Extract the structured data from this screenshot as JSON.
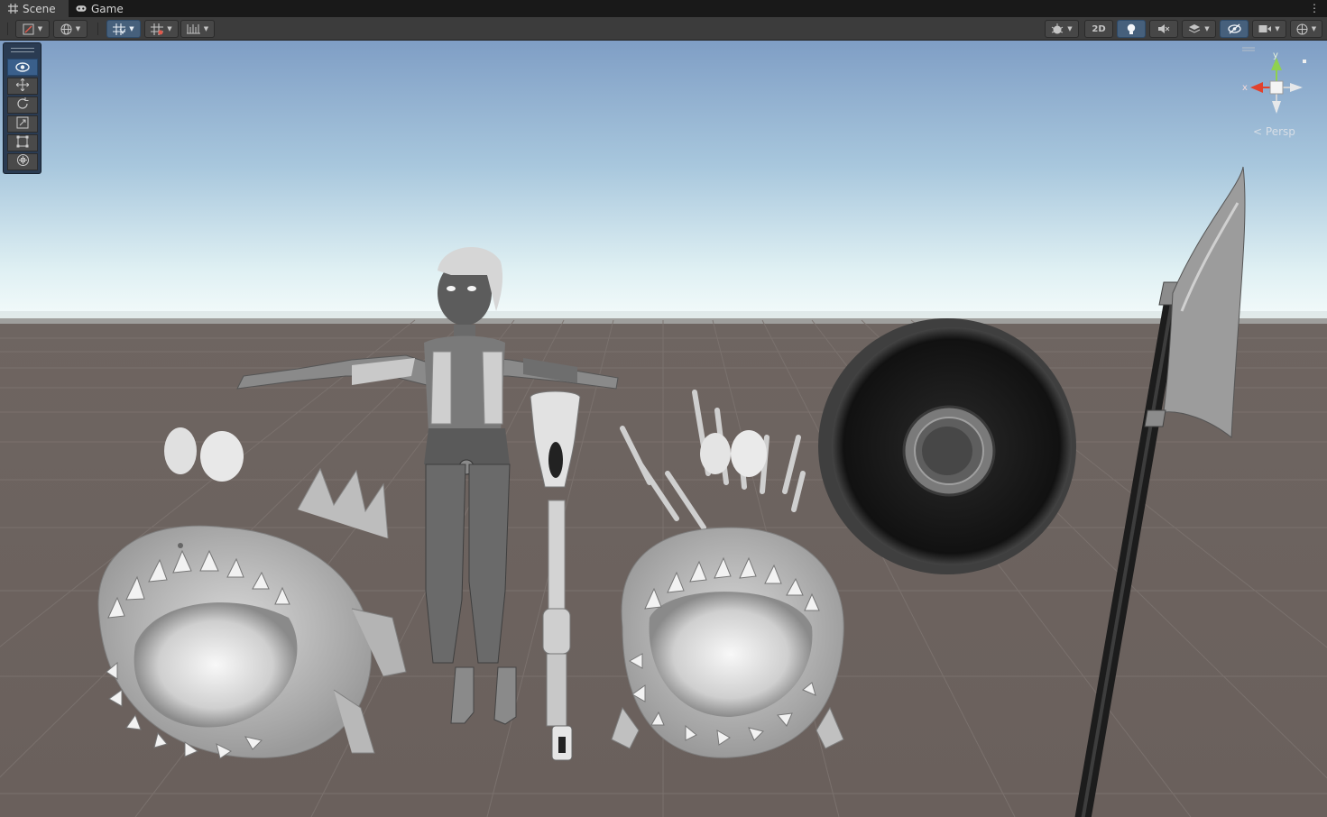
{
  "tabs": [
    {
      "label": "Scene",
      "icon": "grid-icon",
      "active": true
    },
    {
      "label": "Game",
      "icon": "gamepad-icon",
      "active": false
    }
  ],
  "toolbar": {
    "draw_mode_icon": "draw-mode-icon",
    "mode_2d_label": "2D",
    "buttons": [
      "shading-mode",
      "global-icon",
      "grid-snap-icon",
      "grid-icon",
      "ruler-icon",
      "gizmo-icon",
      "2d-toggle",
      "lighting-icon",
      "audio-icon",
      "effects-icon",
      "visibility-icon",
      "camera-icon",
      "orientation-icon"
    ]
  },
  "tools": [
    "view-tool-icon",
    "move-tool-icon",
    "rotate-tool-icon",
    "scale-tool-icon",
    "rect-tool-icon",
    "transform-tool-icon"
  ],
  "gizmo": {
    "y_label": "y",
    "x_label": "x",
    "projection_label": "Persp"
  },
  "colors": {
    "sky_top": "#7f9ec5",
    "horizon": "#e9f6f7",
    "ground": "#6b625e",
    "accent": "#46607c"
  }
}
